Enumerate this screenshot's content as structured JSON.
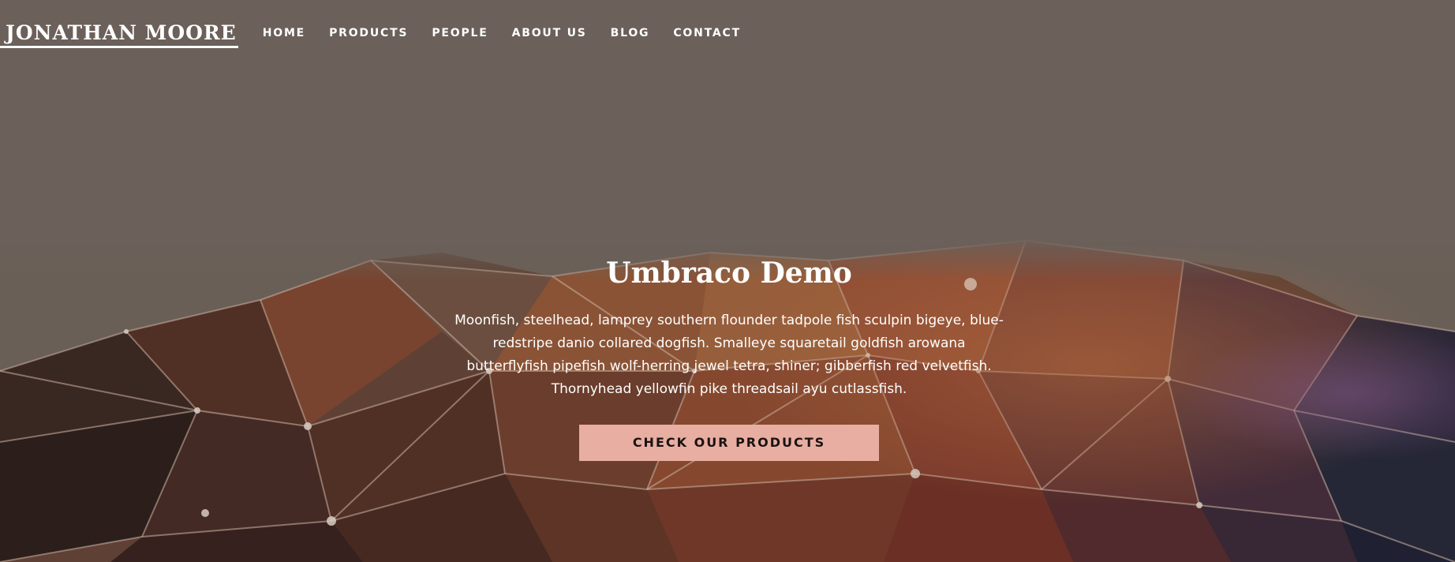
{
  "header": {
    "logo_text": "JONATHAN MOORE",
    "nav": [
      {
        "label": "HOME"
      },
      {
        "label": "PRODUCTS"
      },
      {
        "label": "PEOPLE"
      },
      {
        "label": "ABOUT US"
      },
      {
        "label": "BLOG"
      },
      {
        "label": "CONTACT"
      }
    ]
  },
  "hero": {
    "title": "Umbraco Demo",
    "description": "Moonfish, steelhead, lamprey southern flounder tadpole fish sculpin bigeye, blue-redstripe danio collared dogfish. Smalleye squaretail goldfish arowana butterflyfish pipefish wolf-herring jewel tetra, shiner; gibberfish red velvetfish. Thornyhead yellowfin pike threadsail ayu cutlassfish.",
    "cta_label": "CHECK OUR PRODUCTS",
    "background_image": "polygon-network-sphere"
  },
  "colors": {
    "cta_background": "#e8aea1",
    "cta_text": "#1a1212",
    "text": "#ffffff",
    "background_top": "#786e65"
  }
}
